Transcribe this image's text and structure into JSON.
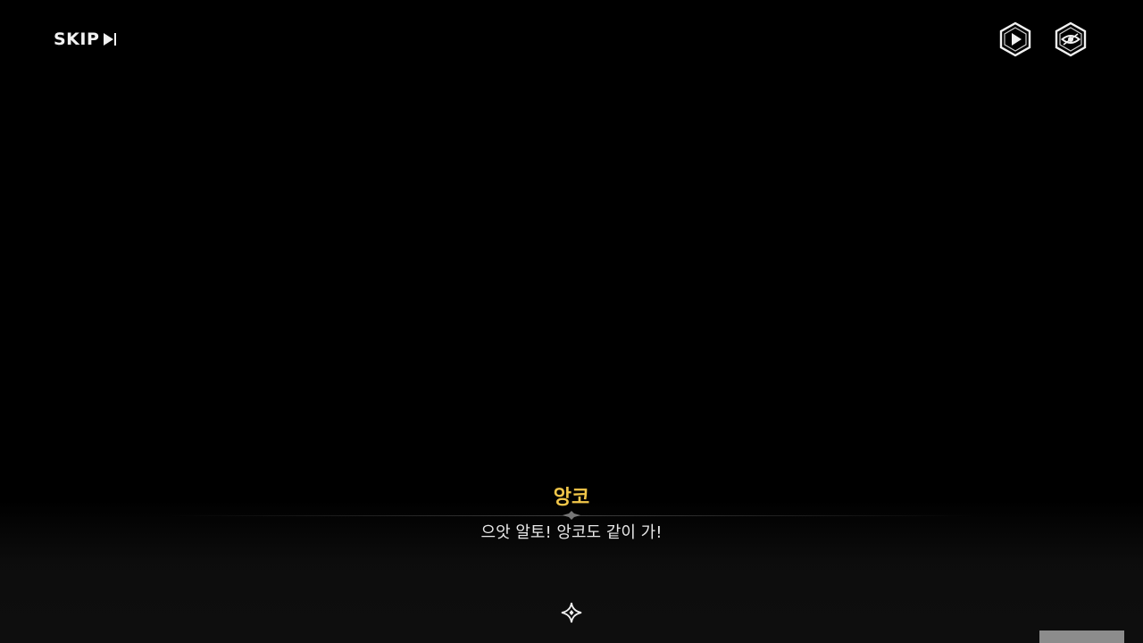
{
  "top_bar": {
    "skip_label": "SKIP",
    "skip_icon": "skip-forward-icon",
    "autoplay_icon": "play-hexagon-icon",
    "hide_ui_icon": "eye-hexagon-icon"
  },
  "dialogue": {
    "speaker": "앙코",
    "text": "으앗 알토! 앙코도 같이 가!",
    "divider_icon": "ornament-icon"
  },
  "advance": {
    "icon": "four-point-star-icon"
  },
  "colors": {
    "background": "#000000",
    "speaker_name": "#f2c74a",
    "dialogue_text": "#e8e8e8",
    "ui_white": "#f2f2f2",
    "corner_panel": "#8c8c8c"
  }
}
